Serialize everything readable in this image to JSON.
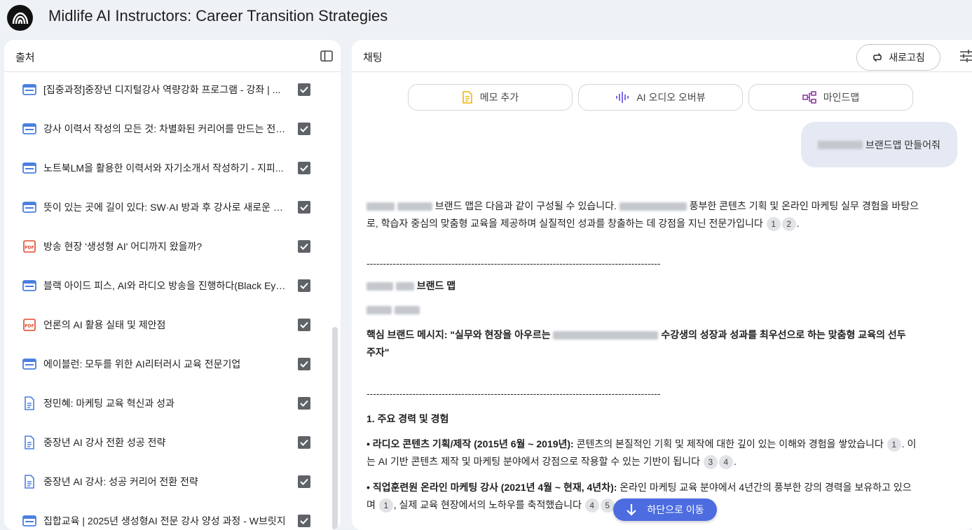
{
  "app": {
    "title": "Midlife AI Instructors: Career Transition Strategies"
  },
  "sources_panel": {
    "title": "출처",
    "items": [
      {
        "type": "web",
        "title": "[집중과정]중장년 디지털강사 역량강화 프로그램 - 강좌 | ..."
      },
      {
        "type": "web",
        "title": "강사 이력서 작성의 모든 것: 차별화된 커리어를 만드는 전략..."
      },
      {
        "type": "web",
        "title": "노트북LM을 활용한 이력서와 자기소개서 작성하기 - 지피..."
      },
      {
        "type": "web",
        "title": "뜻이 있는 곳에 길이 있다: SW·AI 방과 후 강사로 새로운 도..."
      },
      {
        "type": "pdf",
        "title": "방송 현장 '생성형 AI' 어디까지 왔을까?"
      },
      {
        "type": "web",
        "title": "블랙 아이드 피스, AI와 라디오 방송을 진행하다(Black Eye..."
      },
      {
        "type": "pdf",
        "title": "언론의 AI 활용 실태 및 제안점"
      },
      {
        "type": "web",
        "title": "에이블런: 모두를 위한 AI리터러시 교육 전문기업"
      },
      {
        "type": "doc",
        "title": "정민혜: 마케팅 교육 혁신과 성과"
      },
      {
        "type": "doc",
        "title": "중장년 AI 강사 전환 성공 전략"
      },
      {
        "type": "doc",
        "title": "중장년 AI 강사: 성공 커리어 전환 전략"
      },
      {
        "type": "web",
        "title": "집합교육 | 2025년 생성형AI 전문 강사 양성 과정 - W브릿지"
      }
    ]
  },
  "chat_panel": {
    "title": "채팅",
    "refresh_label": "새로고침",
    "actions": [
      {
        "label": "메모 추가",
        "icon": "note-icon"
      },
      {
        "label": "AI 오디오 오버뷰",
        "icon": "audio-wave-icon"
      },
      {
        "label": "마인드맵",
        "icon": "mindmap-icon"
      }
    ],
    "user_message": "브랜드맵 만들어줘",
    "answer": {
      "intro_a": "브랜드 맵은 다음과 같이 구성될 수 있습니다.",
      "intro_b": "풍부한 콘텐츠 기획 및 온라인 마케팅 실무 경험을 바탕으",
      "intro_c": "로, 학습자 중심의 맞춤형 교육을 제공하며 실질적인 성과를 창출하는 데 강점을 지닌 전문가입니다",
      "divider": "------------------------------------------------------------------------------------------",
      "brand_map_heading": "브랜드 맵",
      "message_label": "핵심 브랜드 메시지: \"실무와 현장을 아우르는",
      "message_rest": "수강생의 성장과 성과를 최우선으로 하는 맞춤형 교육의 선두",
      "message_end": "주자\"",
      "section1": "1. 주요 경력 및 경험",
      "bullet1_head": "• 라디오 콘텐츠 기획/제작 (2015년 6월 ~ 2019년):",
      "bullet1_body": "콘텐츠의 본질적인 기획 및 제작에 대한 깊이 있는 이해와 경험을 쌓았습니다",
      "bullet1_tail_a": ". 이",
      "bullet1_line2": "는 AI 기반 콘텐츠 제작 및 마케팅 분야에서 강점으로 작용할 수 있는 기반이 됩니다",
      "bullet2_head": "• 직업훈련원 온라인 마케팅 강사 (2021년 4월 ~ 현재, 4년차):",
      "bullet2_body": "온라인 마케팅 교육 분야에서 4년간의 풍부한 강의 경력을 보유하고 있으",
      "bullet2_line2a": "며",
      "bullet2_line2b": ", 실제 교육 현장에서의 노하우를 축적했습니다",
      "citations": {
        "c1": "1",
        "c2": "2",
        "c3": "3",
        "c4": "4",
        "c5": "5"
      }
    },
    "scroll_down_label": "하단으로 이동"
  },
  "colors": {
    "accent": "#4c6ce0",
    "web_icon": "#4a7fe0",
    "pdf_icon": "#e0492f",
    "checkbox": "#5f6368"
  }
}
